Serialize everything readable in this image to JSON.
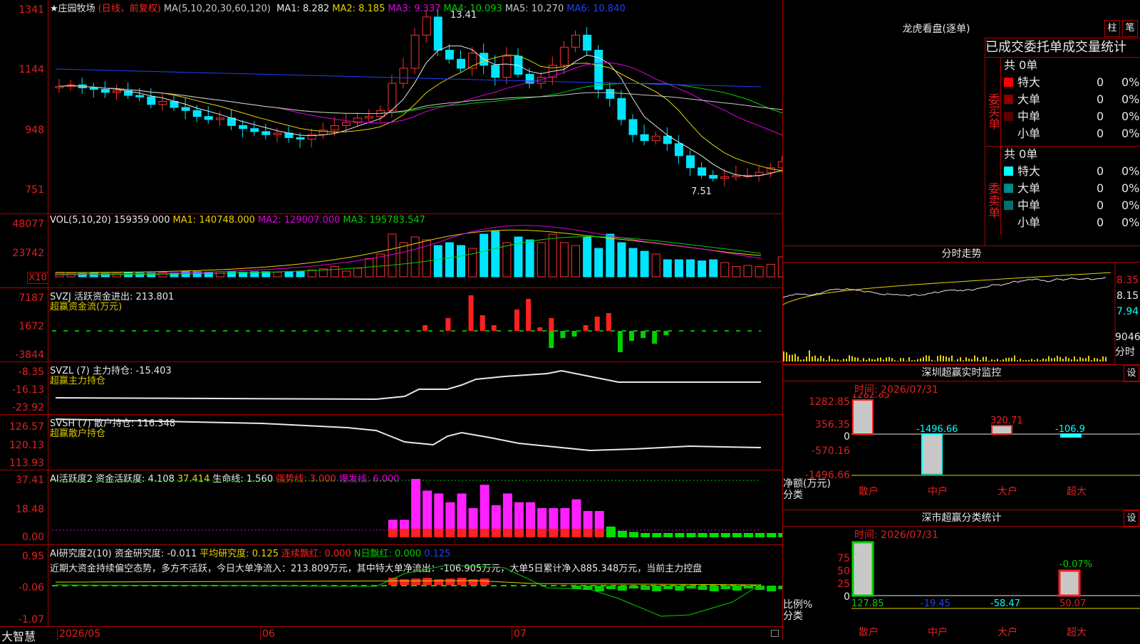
{
  "stock": {
    "name": "★庄园牧场",
    "mode": "(日线，前复权)",
    "ma_label": "MA(5,10,20,30,60,120)"
  },
  "ma": [
    {
      "label": "MA1: 8.282",
      "color": "#e8e8e8"
    },
    {
      "label": "MA2: 8.185",
      "color": "#e8d400"
    },
    {
      "label": "MA3: 9.337",
      "color": "#e000e0"
    },
    {
      "label": "MA4: 10.093",
      "color": "#00d000"
    },
    {
      "label": "MA5: 10.270",
      "color": "#c8c8c8"
    },
    {
      "label": "MA6: 10.840",
      "color": "#2040ff"
    }
  ],
  "price_axis": [
    "1341",
    "1144",
    "948",
    "751"
  ],
  "price_marks": {
    "high": "13.41",
    "low": "7.51"
  },
  "vol": {
    "label": "VOL(5,10,20)",
    "value": "159359.000",
    "ma1": "MA1: 140748.000",
    "ma2": "MA2: 129007.000",
    "ma3": "MA3: 195783.547",
    "axis": [
      "48077",
      "23742"
    ],
    "unit": "X10"
  },
  "svzj": {
    "label": "SVZJ  活跃资金进出: 213.801",
    "sub": "超赢资金流(万元)",
    "axis": [
      "7187",
      "1672",
      "-3844"
    ]
  },
  "svzl": {
    "label": "SVZL (7) 主力持仓: -15.403",
    "sub": "超赢主力持仓",
    "axis": [
      "-8.35",
      "-16.13",
      "-23.92"
    ]
  },
  "svsh": {
    "label": "SVSH (7) 散户持仓: 116.348",
    "sub": "超赢散户持仓",
    "axis": [
      "126.57",
      "120.13",
      "113.93"
    ]
  },
  "ai1": {
    "label": "AI活跃度2 资金活跃度: 4.108",
    "v2": "37.414",
    "life": "生命线: 1.560",
    "strong": "强势线: 3.000",
    "burst": "爆发线: 6.000",
    "axis": [
      "37.41",
      "18.48",
      "0.00"
    ]
  },
  "ai2": {
    "label": "AI研究度2(10) 资金研究度: -0.011",
    "avg": "平均研究度: 0.125",
    "red": "连续飘红: 0.000",
    "nred": "N日飘红: 0.000",
    "last": "0.125",
    "axis": [
      "0.95",
      "-0.06",
      "-1.07"
    ],
    "note": "近期大资金持续偏空态势，多方不活跃，今日大单净流入：213.809万元，其中特大单净流出：-106.905万元，大单5日累计净入885.348万元，当前主力控盘"
  },
  "xaxis": {
    "brand": "大智慧",
    "d1": "2026/05",
    "d2": "06",
    "d3": "07"
  },
  "dragon": {
    "title": "龙虎看盘(逐单)",
    "btn1": "柱",
    "btn2": "笔",
    "subtitle": "已成交委托单成交量统计",
    "buy_label": "委买单",
    "sell_label": "委卖单",
    "buy_total": "共 0单",
    "sell_total": "共 0单",
    "buy_rows": [
      {
        "name": "特大",
        "color": "#ff0000",
        "n": "0",
        "p": "0%"
      },
      {
        "name": "大单",
        "color": "#8a0000",
        "n": "0",
        "p": "0%"
      },
      {
        "name": "中单",
        "color": "#5a0000",
        "n": "0",
        "p": "0%"
      },
      {
        "name": "小单",
        "color": "#000000",
        "n": "0",
        "p": "0%"
      }
    ],
    "sell_rows": [
      {
        "name": "特大",
        "color": "#00ffff",
        "n": "0",
        "p": "0%"
      },
      {
        "name": "大单",
        "color": "#008888",
        "n": "0",
        "p": "0%"
      },
      {
        "name": "中单",
        "color": "#007070",
        "n": "0",
        "p": "0%"
      },
      {
        "name": "小单",
        "color": "#000000",
        "n": "0",
        "p": "0%"
      }
    ]
  },
  "intraday": {
    "title": "分时走势",
    "axis": [
      "8.35",
      "8.15",
      "7.94",
      "9046"
    ],
    "unit": "分时"
  },
  "monitor": {
    "title": "深圳超赢实时监控",
    "btn": "设",
    "time": "时间: 2026/07/31",
    "axis": [
      "1282.85",
      "356.35",
      "0",
      "-570.16",
      "-1496.66"
    ],
    "ylabel": "净额(万元)",
    "xlabel": "分类",
    "cats": [
      "散户",
      "中户",
      "大户",
      "超大"
    ],
    "vals": [
      "1282.85",
      "-1496.66",
      "320.71",
      "-106.9"
    ]
  },
  "classify": {
    "title": "深市超赢分类统计",
    "btn": "设",
    "time": "时间: 2026/07/31",
    "axis": [
      "75",
      "50",
      "25",
      "0"
    ],
    "ylabel": "比例%",
    "xlabel": "分类",
    "cats": [
      "散户",
      "中户",
      "大户",
      "超大"
    ],
    "vals": [
      "127.85",
      "-19.45",
      "-58.47",
      "50.07"
    ],
    "top": "-0.07%"
  }
}
